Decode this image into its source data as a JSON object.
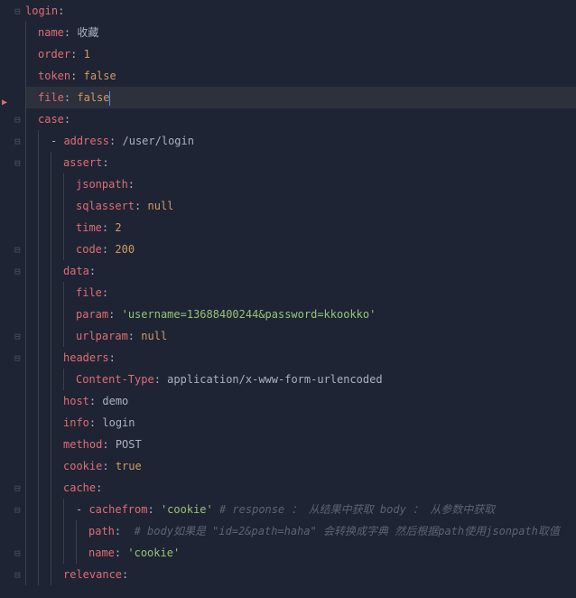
{
  "lines": [
    {
      "indent": 0,
      "dash": false,
      "key": "login",
      "value": "",
      "vtype": "none"
    },
    {
      "indent": 1,
      "dash": false,
      "key": "name",
      "value": "收藏",
      "vtype": "str"
    },
    {
      "indent": 1,
      "dash": false,
      "key": "order",
      "value": "1",
      "vtype": "num"
    },
    {
      "indent": 1,
      "dash": false,
      "key": "token",
      "value": "false",
      "vtype": "bool"
    },
    {
      "indent": 1,
      "dash": false,
      "key": "file",
      "value": "false",
      "vtype": "bool",
      "highlighted": true,
      "cursor": true
    },
    {
      "indent": 1,
      "dash": false,
      "key": "case",
      "value": "",
      "vtype": "none"
    },
    {
      "indent": 2,
      "dash": true,
      "key": "address",
      "value": "/user/login",
      "vtype": "str"
    },
    {
      "indent": 3,
      "dash": false,
      "key": "assert",
      "value": "",
      "vtype": "none"
    },
    {
      "indent": 4,
      "dash": false,
      "key": "jsonpath",
      "value": "",
      "vtype": "none"
    },
    {
      "indent": 4,
      "dash": false,
      "key": "sqlassert",
      "value": "null",
      "vtype": "null"
    },
    {
      "indent": 4,
      "dash": false,
      "key": "time",
      "value": "2",
      "vtype": "num"
    },
    {
      "indent": 4,
      "dash": false,
      "key": "code",
      "value": "200",
      "vtype": "num"
    },
    {
      "indent": 3,
      "dash": false,
      "key": "data",
      "value": "",
      "vtype": "none"
    },
    {
      "indent": 4,
      "dash": false,
      "key": "file",
      "value": "",
      "vtype": "none"
    },
    {
      "indent": 4,
      "dash": false,
      "key": "param",
      "value": "'username=13688400244&password=kkookko'",
      "vtype": "qstr"
    },
    {
      "indent": 4,
      "dash": false,
      "key": "urlparam",
      "value": "null",
      "vtype": "null"
    },
    {
      "indent": 3,
      "dash": false,
      "key": "headers",
      "value": "",
      "vtype": "none"
    },
    {
      "indent": 4,
      "dash": false,
      "key": "Content-Type",
      "value": "application/x-www-form-urlencoded",
      "vtype": "str"
    },
    {
      "indent": 3,
      "dash": false,
      "key": "host",
      "value": "demo",
      "vtype": "str"
    },
    {
      "indent": 3,
      "dash": false,
      "key": "info",
      "value": "login",
      "vtype": "str"
    },
    {
      "indent": 3,
      "dash": false,
      "key": "method",
      "value": "POST",
      "vtype": "str"
    },
    {
      "indent": 3,
      "dash": false,
      "key": "cookie",
      "value": "true",
      "vtype": "bool"
    },
    {
      "indent": 3,
      "dash": false,
      "key": "cache",
      "value": "",
      "vtype": "none"
    },
    {
      "indent": 4,
      "dash": true,
      "key": "cachefrom",
      "value": "'cookie'",
      "vtype": "qstr",
      "comment": "# response ： 从结果中获取 body ： 从参数中获取"
    },
    {
      "indent": 5,
      "dash": false,
      "key": "path",
      "value": "",
      "vtype": "none",
      "comment": " # body如果是 \"id=2&path=haha\" 会转换成字典 然后根据path使用jsonpath取值"
    },
    {
      "indent": 5,
      "dash": false,
      "key": "name",
      "value": "'cookie'",
      "vtype": "qstr"
    },
    {
      "indent": 3,
      "dash": false,
      "key": "relevance",
      "value": "",
      "vtype": "none"
    }
  ],
  "gutter": {
    "breakpoint_line": 4,
    "fold_lines": [
      0,
      5,
      6,
      7,
      11,
      12,
      15,
      16,
      22,
      23,
      25,
      26
    ]
  }
}
